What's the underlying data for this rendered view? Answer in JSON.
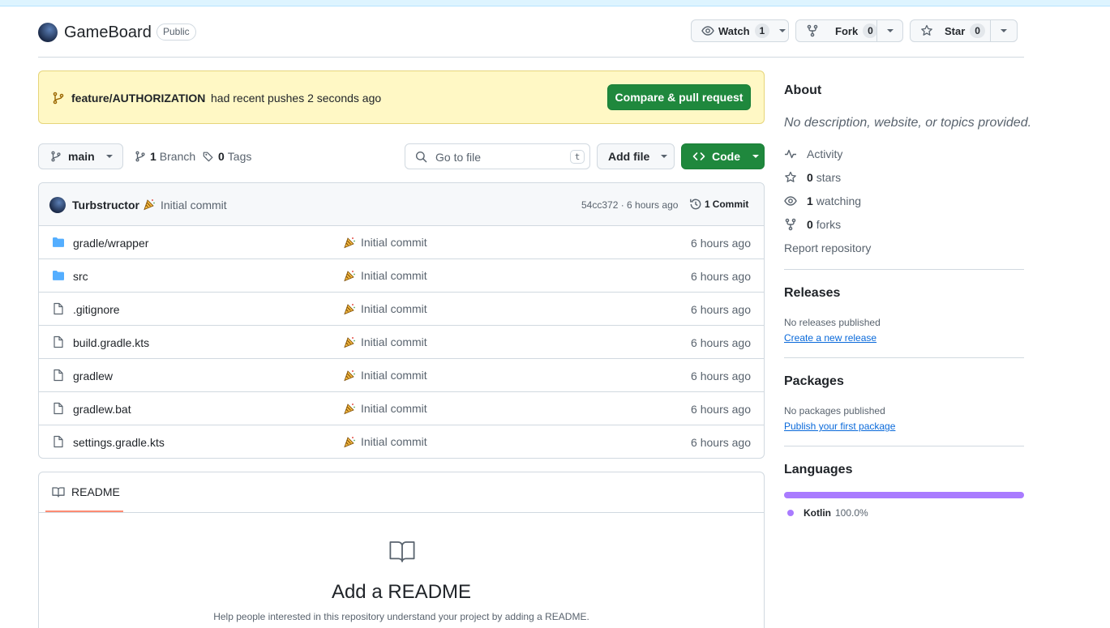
{
  "repo": {
    "name": "GameBoard",
    "visibility": "Public"
  },
  "actions": {
    "watch_label": "Watch",
    "watch_count": "1",
    "fork_label": "Fork",
    "fork_count": "0",
    "star_label": "Star",
    "star_count": "0"
  },
  "banner": {
    "branch": "feature/AUTHORIZATION",
    "text": "had recent pushes 2 seconds ago",
    "button": "Compare & pull request"
  },
  "toolbar": {
    "branch": "main",
    "branches_count": "1",
    "branches_label": "Branch",
    "tags_count": "0",
    "tags_label": "Tags",
    "search_placeholder": "Go to file",
    "search_shortcut": "t",
    "add_file": "Add file",
    "code": "Code"
  },
  "latest_commit": {
    "author": "Turbstructor",
    "message": "Initial commit",
    "sha_age": "54cc372 · 6 hours ago",
    "commits_count": "1",
    "commits_label": "Commit"
  },
  "files": [
    {
      "type": "folder",
      "name": "gradle/wrapper",
      "message": "Initial commit",
      "age": "6 hours ago"
    },
    {
      "type": "folder",
      "name": "src",
      "message": "Initial commit",
      "age": "6 hours ago"
    },
    {
      "type": "file",
      "name": ".gitignore",
      "message": "Initial commit",
      "age": "6 hours ago"
    },
    {
      "type": "file",
      "name": "build.gradle.kts",
      "message": "Initial commit",
      "age": "6 hours ago"
    },
    {
      "type": "file",
      "name": "gradlew",
      "message": "Initial commit",
      "age": "6 hours ago"
    },
    {
      "type": "file",
      "name": "gradlew.bat",
      "message": "Initial commit",
      "age": "6 hours ago"
    },
    {
      "type": "file",
      "name": "settings.gradle.kts",
      "message": "Initial commit",
      "age": "6 hours ago"
    }
  ],
  "readme": {
    "tab": "README",
    "title": "Add a README",
    "description": "Help people interested in this repository understand your project by adding a README."
  },
  "about": {
    "heading": "About",
    "description": "No description, website, or topics provided.",
    "activity": "Activity",
    "stars_count": "0",
    "stars_label": "stars",
    "watching_count": "1",
    "watching_label": "watching",
    "forks_count": "0",
    "forks_label": "forks",
    "report": "Report repository"
  },
  "releases": {
    "heading": "Releases",
    "text": "No releases published",
    "link": "Create a new release"
  },
  "packages": {
    "heading": "Packages",
    "text": "No packages published",
    "link": "Publish your first package"
  },
  "languages": {
    "heading": "Languages",
    "items": [
      {
        "name": "Kotlin",
        "percent": "100.0%",
        "color": "#A97BFF"
      }
    ]
  },
  "colors": {
    "primary_green": "#1f883d",
    "banner_bg": "#fff8c5",
    "folder_blue": "#54aeff"
  }
}
